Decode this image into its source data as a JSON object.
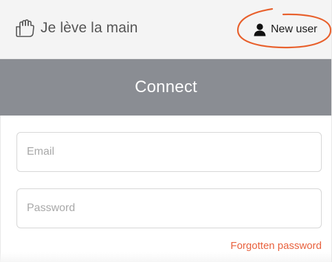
{
  "header": {
    "app_name": "Je lève la main",
    "logo_icon": "raised-hand-icon",
    "new_user_label": "New user",
    "new_user_icon": "user-icon",
    "annotation_color": "#e8602c"
  },
  "connect": {
    "title": "Connect",
    "bar_color": "#8a8d93"
  },
  "form": {
    "email": {
      "placeholder": "Email",
      "value": ""
    },
    "password": {
      "placeholder": "Password",
      "value": ""
    },
    "forgot_password_label": "Forgotten password",
    "link_color": "#e8603c"
  }
}
